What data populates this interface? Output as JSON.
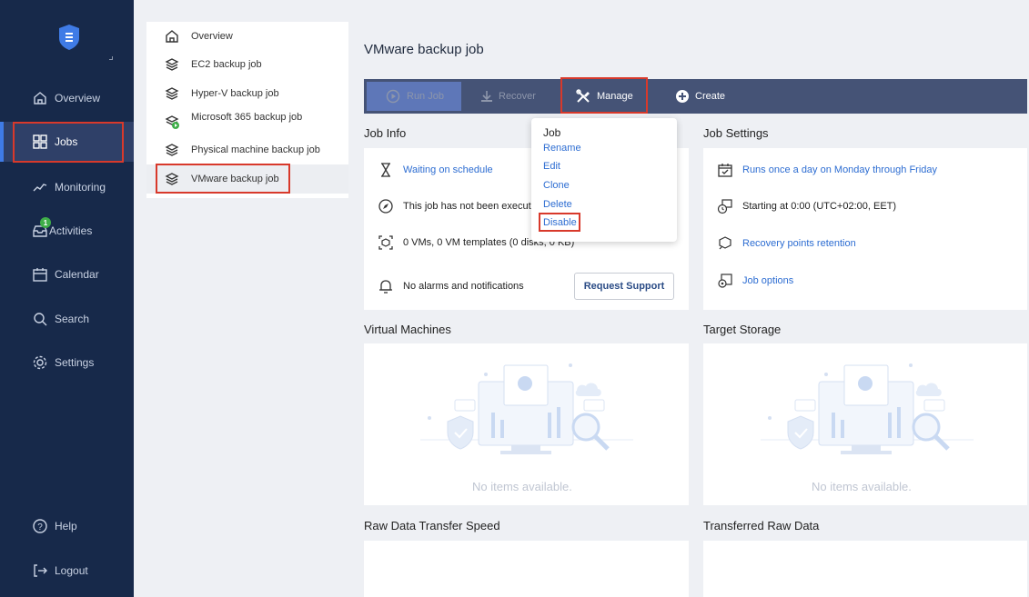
{
  "nav": {
    "items": [
      {
        "label": "Overview",
        "icon": "home-icon"
      },
      {
        "label": "Jobs",
        "icon": "grid-icon"
      },
      {
        "label": "Monitoring",
        "icon": "pulse-icon"
      },
      {
        "label": "Activities",
        "icon": "inbox-icon",
        "badge": "1"
      },
      {
        "label": "Calendar",
        "icon": "calendar-icon"
      },
      {
        "label": "Search",
        "icon": "search-icon"
      },
      {
        "label": "Settings",
        "icon": "gear-icon"
      }
    ],
    "help": "Help",
    "logout": "Logout"
  },
  "tree": {
    "items": [
      "Overview",
      "EC2 backup job",
      "Hyper-V backup job",
      "Microsoft 365 backup job",
      "Physical machine backup job",
      "VMware backup job"
    ]
  },
  "page_title": "VMware backup job",
  "toolbar": {
    "run_job": "Run Job",
    "recover": "Recover",
    "manage": "Manage",
    "create": "Create"
  },
  "dropdown": {
    "header": "Job",
    "items": [
      "Rename",
      "Edit",
      "Clone",
      "Delete",
      "Disable"
    ]
  },
  "job_info": {
    "title": "Job Info",
    "status": "Waiting on schedule",
    "executed": "This job has not been execut",
    "vms": "0 VMs, 0 VM templates (0 disks, 0 KB)",
    "alarms": "No alarms and notifications",
    "request_support": "Request Support"
  },
  "job_settings": {
    "title": "Job Settings",
    "schedule": "Runs once a day on Monday through Friday",
    "start": "Starting at 0:00 (UTC+02:00, EET)",
    "retention": "Recovery points retention",
    "options": "Job options"
  },
  "virtual_machines": {
    "title": "Virtual Machines",
    "empty": "No items available."
  },
  "target_storage": {
    "title": "Target Storage",
    "empty": "No items available."
  },
  "raw_speed": {
    "title": "Raw Data Transfer Speed"
  },
  "raw_transferred": {
    "title": "Transferred Raw Data"
  },
  "colors": {
    "sidebar_bg": "#17294a",
    "toolbar_bg": "#455376",
    "link": "#2d6dd2",
    "highlight_border": "#d8392b",
    "badge": "#3fae49"
  }
}
